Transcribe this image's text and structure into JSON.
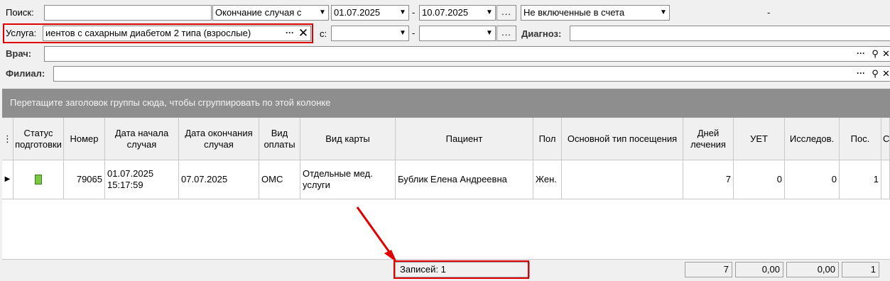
{
  "filters": {
    "search_label": "Поиск:",
    "search_value": "",
    "date_type": "Окончание случая с",
    "date_from": "01.07.2025",
    "dash1": "-",
    "date_to": "10.07.2025",
    "dots": "...",
    "billing_status": "Не включенные в счета",
    "extra_dash": "-",
    "service_label": "Услуга:",
    "service_value": "иентов с сахарным диабетом 2 типа (взрослые)",
    "service_dots": "···",
    "c_label": "с:",
    "c_from": "",
    "dash2": "-",
    "c_to": "",
    "dots2": "...",
    "diagnosis_label": "Диагноз:",
    "diagnosis_value": "",
    "doctor_label": "Врач:",
    "doctor_value": "",
    "branch_label": "Филиал:",
    "branch_value": "",
    "lookup_dots": "···"
  },
  "group_panel": {
    "text": "Перетащите заголовок группы сюда, чтобы сгруппировать по этой колонке"
  },
  "grid": {
    "columns": [
      "Статус подготовки",
      "Номер",
      "Дата начала случая",
      "Дата окончания случая",
      "Вид оплаты",
      "Вид карты",
      "Пациент",
      "Пол",
      "Основной тип посещения",
      "Дней лечения",
      "УЕТ",
      "Исследов.",
      "Пос.",
      "С"
    ],
    "rows": [
      {
        "number": "79065",
        "start_date": "01.07.2025",
        "start_time": "15:17:59",
        "end_date": "07.07.2025",
        "payment": "ОМС",
        "card_type": "Отдельные мед. услуги",
        "patient": "Бублик Елена Андреевна",
        "sex": "Жен.",
        "visit_type": "",
        "days": "7",
        "uet": "0",
        "research": "0",
        "visits": "1"
      }
    ]
  },
  "footer": {
    "records": "Записей: 1",
    "days_total": "7",
    "uet_total": "0,00",
    "research_total": "0,00",
    "visits_total": "1"
  },
  "annotation_color": "#e00000"
}
